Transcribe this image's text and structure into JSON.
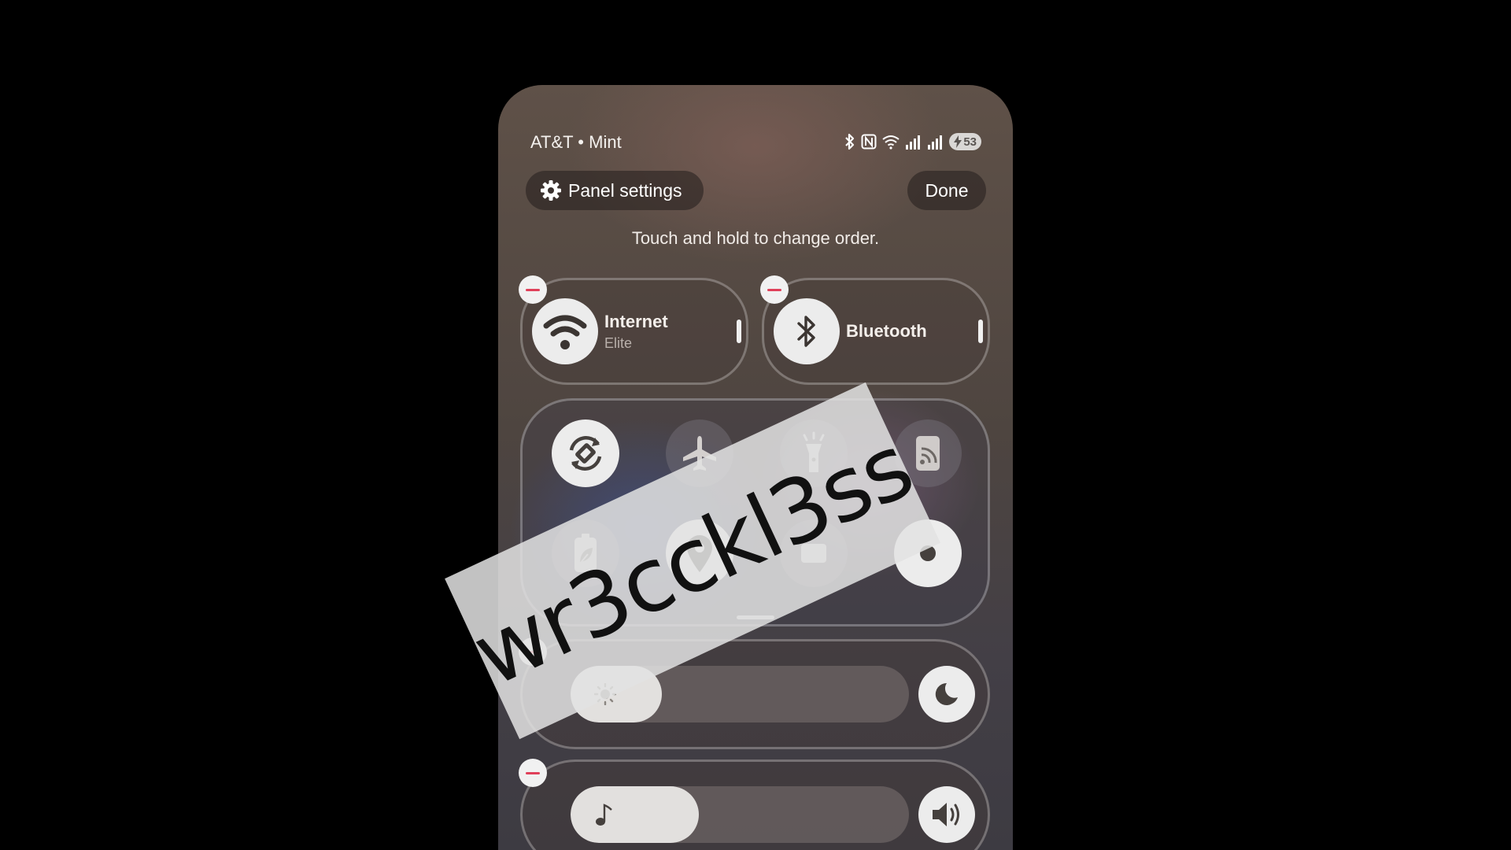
{
  "status_bar": {
    "carrier": "AT&T • Mint",
    "battery_level": "53",
    "icons": [
      "bluetooth-icon",
      "nfc-icon",
      "wifi-icon",
      "signal-icon",
      "signal-icon",
      "battery-charging-icon"
    ]
  },
  "header": {
    "panel_settings_label": "Panel settings",
    "done_label": "Done",
    "hint": "Touch and hold to change order."
  },
  "tiles": {
    "internet": {
      "title": "Internet",
      "subtitle": "Elite",
      "icon": "wifi-icon"
    },
    "bluetooth": {
      "title": "Bluetooth",
      "icon": "bluetooth-icon"
    }
  },
  "quick_settings": [
    {
      "icon": "auto-rotate-icon",
      "on": true
    },
    {
      "icon": "airplane-icon",
      "on": false
    },
    {
      "icon": "flashlight-icon",
      "on": false
    },
    {
      "icon": "cast-icon",
      "on": false
    },
    {
      "icon": "power-saving-icon",
      "on": false
    },
    {
      "icon": "location-icon",
      "on": true
    },
    {
      "icon": "tile-icon",
      "on": false
    },
    {
      "icon": "tile-icon",
      "on": true
    }
  ],
  "sliders": {
    "brightness": {
      "icon": "sun-icon",
      "level": 0.27,
      "button_icon": "moon-icon"
    },
    "volume": {
      "icon": "music-note-icon",
      "level": 0.38,
      "button_icon": "speaker-icon"
    }
  },
  "watermark": {
    "text": "wr3cckl3ss"
  },
  "colors": {
    "remove_badge": "#e0405a",
    "active_tile": "#ececec"
  }
}
